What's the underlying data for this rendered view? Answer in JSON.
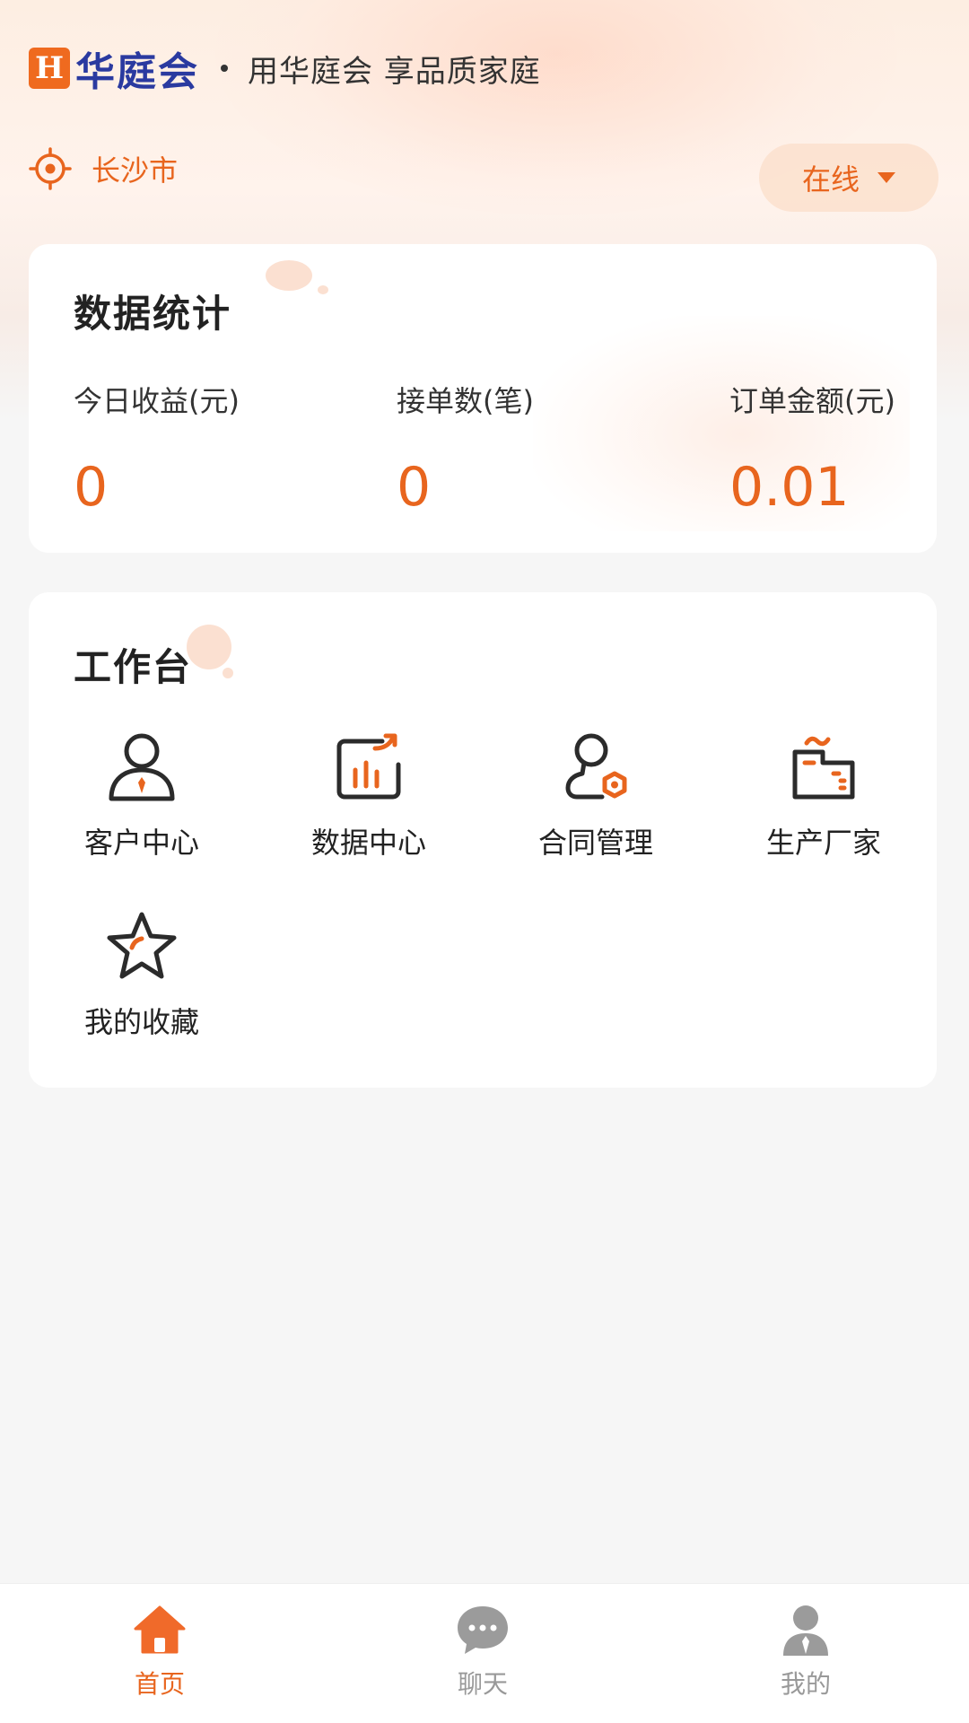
{
  "header": {
    "logo_mark": "H",
    "logo_text": "华庭会",
    "slogan": "用华庭会 享品质家庭"
  },
  "location": {
    "city": "长沙市",
    "icon": "location-target-icon"
  },
  "status": {
    "label": "在线",
    "icon": "caret-down-icon"
  },
  "stats": {
    "title": "数据统计",
    "items": [
      {
        "label": "今日收益(元)",
        "value": "0"
      },
      {
        "label": "接单数(笔)",
        "value": "0"
      },
      {
        "label": "订单金额(元)",
        "value": "0.01"
      }
    ]
  },
  "workbench": {
    "title": "工作台",
    "items": [
      {
        "label": "客户中心",
        "icon": "customer-icon"
      },
      {
        "label": "数据中心",
        "icon": "data-chart-icon"
      },
      {
        "label": "合同管理",
        "icon": "contract-stamp-icon"
      },
      {
        "label": "生产厂家",
        "icon": "factory-icon"
      },
      {
        "label": "我的收藏",
        "icon": "star-icon"
      }
    ]
  },
  "tabbar": {
    "items": [
      {
        "label": "首页",
        "icon": "home-icon",
        "active": true
      },
      {
        "label": "聊天",
        "icon": "chat-icon",
        "active": false
      },
      {
        "label": "我的",
        "icon": "user-icon",
        "active": false
      }
    ]
  },
  "colors": {
    "accent": "#e8651e",
    "brand_blue": "#2a3aa0",
    "text": "#222222",
    "inactive": "#999999"
  }
}
